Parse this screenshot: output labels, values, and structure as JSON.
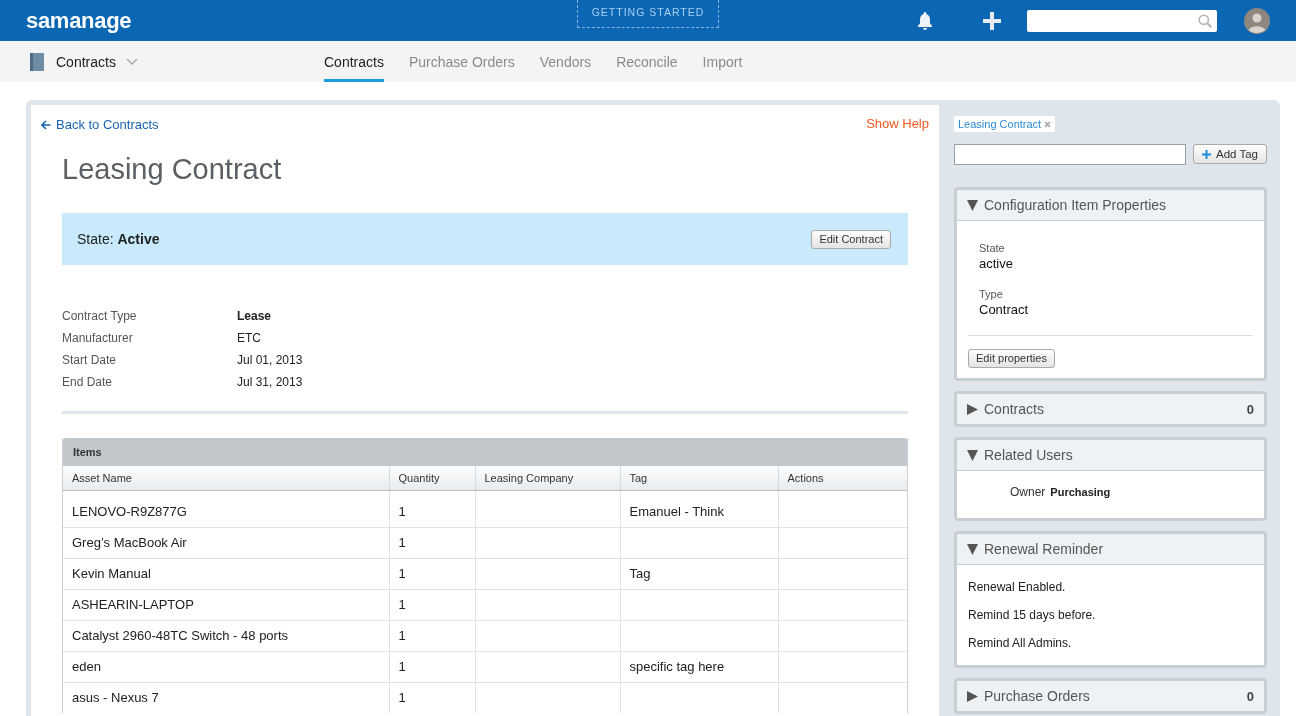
{
  "top_bar": {
    "logo": "samanage",
    "getting_started": "GETTING STARTED"
  },
  "sub_nav": {
    "module": "Contracts",
    "tabs": [
      {
        "label": "Contracts",
        "selected": true
      },
      {
        "label": "Purchase Orders",
        "selected": false
      },
      {
        "label": "Vendors",
        "selected": false
      },
      {
        "label": "Reconcile",
        "selected": false
      },
      {
        "label": "Import",
        "selected": false
      }
    ]
  },
  "main": {
    "back_link": "Back to Contracts",
    "help_link": "Show Help",
    "title": "Leasing Contract",
    "state": "State: **Active**",
    "edit_button": "Edit Contract",
    "details": [
      {
        "label": "Contract Type",
        "value": "Lease",
        "bold": true
      },
      {
        "label": "Manufacturer",
        "value": "ETC",
        "bold": false
      },
      {
        "label": "Start Date",
        "value": "Jul 01, 2013",
        "bold": false
      },
      {
        "label": "End Date",
        "value": "Jul 31, 2013",
        "bold": false
      }
    ],
    "table": {
      "title": "Items",
      "columns": [
        "Asset Name",
        "Quantity",
        "Leasing Company",
        "Tag",
        "Actions"
      ],
      "rows": [
        {
          "asset_name": "LENOVO-R9Z877G",
          "quantity": "1",
          "tag": "Emanuel - Think"
        },
        {
          "asset_name": "Greg’s MacBook Air",
          "quantity": "1"
        },
        {
          "asset_name": "Kevin Manual",
          "quantity": "1",
          "tag": "Tag"
        },
        {
          "asset_name": "ASHEARIN-LAPTOP",
          "quantity": "1"
        },
        {
          "asset_name": "Catalyst 2960-48TC Switch - 48 ports",
          "quantity": "1"
        },
        {
          "asset_name": "eden",
          "quantity": "1",
          "tag": "specific tag here"
        },
        {
          "asset_name": "asus - Nexus 7",
          "quantity": "1"
        }
      ]
    }
  },
  "sidebar": {
    "tags": [
      {
        "label": "Leasing Contract"
      }
    ],
    "add_tag_button": "Add Tag",
    "panels": [
      {
        "kind": "properties",
        "title": "Configuration Item Properties",
        "expanded": true,
        "fields": [
          {
            "label": "State",
            "value": "active"
          },
          {
            "label": "Type",
            "value": "Contract"
          }
        ],
        "button": "Edit properties"
      },
      {
        "kind": "count",
        "title": "Contracts",
        "expanded": false,
        "count": "0"
      },
      {
        "kind": "users",
        "title": "Related Users",
        "expanded": true,
        "users": [
          {
            "role": "Owner",
            "name": "Purchasing"
          }
        ]
      },
      {
        "kind": "reminder",
        "title": "Renewal Reminder",
        "expanded": true,
        "lines": [
          "Renewal Enabled.",
          "Remind 15 days before.",
          "Remind All Admins."
        ]
      },
      {
        "kind": "count",
        "title": "Purchase Orders",
        "expanded": false,
        "count": "0"
      }
    ]
  }
}
